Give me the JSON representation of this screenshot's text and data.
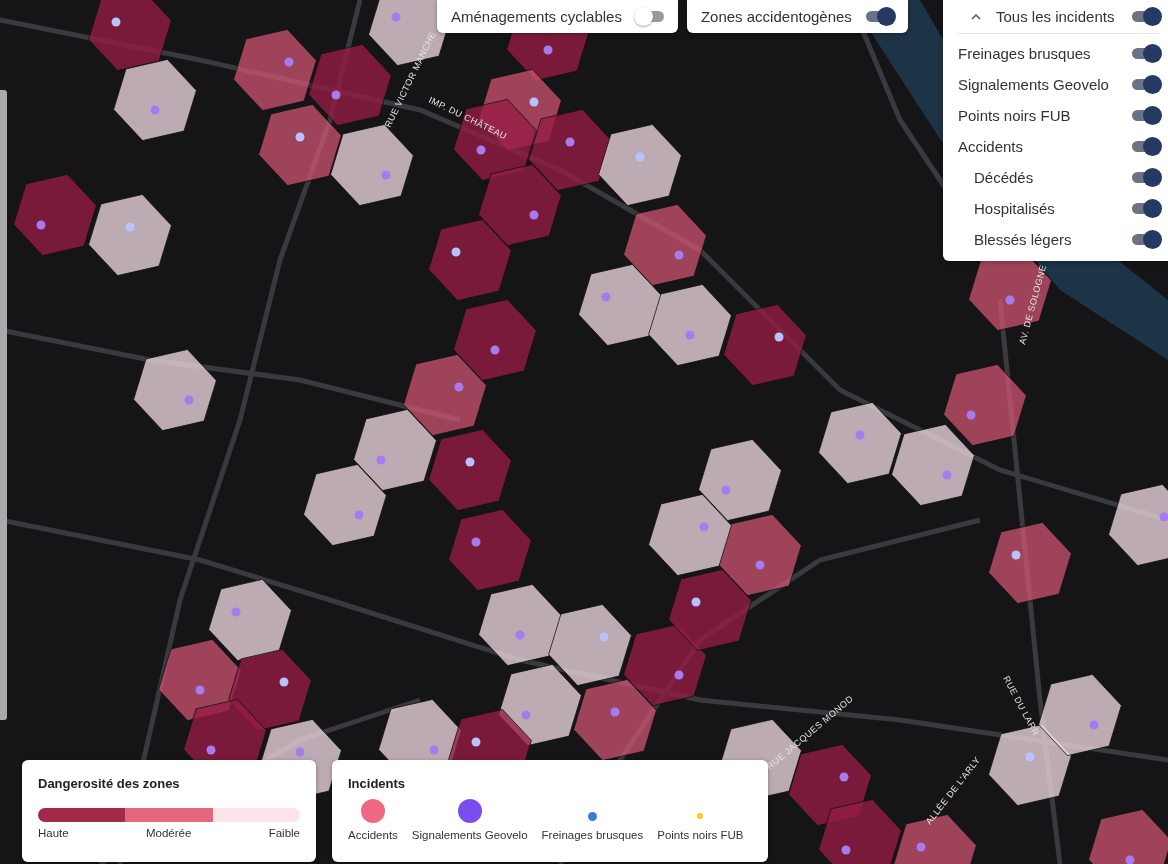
{
  "top_toggles": [
    {
      "label": "Aménagements cyclables",
      "on": false
    },
    {
      "label": "Zones accidentogènes",
      "on": true
    }
  ],
  "incident_filters": {
    "header": {
      "label": "Tous les incidents",
      "on": true,
      "expanded": true
    },
    "items": [
      {
        "label": "Freinages brusques",
        "on": true
      },
      {
        "label": "Signalements Geovelo",
        "on": true
      },
      {
        "label": "Points noirs FUB",
        "on": true
      },
      {
        "label": "Accidents",
        "on": true,
        "children": [
          {
            "label": "Décédés",
            "on": true
          },
          {
            "label": "Hospitalisés",
            "on": true
          },
          {
            "label": "Blessés légers",
            "on": true
          }
        ]
      }
    ]
  },
  "street_labels": [
    "RUE VICTOR MANCHE",
    "IMP. DU CHÂTEAU",
    "AV. DE SOLOGNE",
    "RUE JACQUES MONOD",
    "ALLÉE DE L'ARLY",
    "RUE DU LARR"
  ],
  "danger_legend": {
    "title": "Dangerosité des zones",
    "levels": [
      {
        "label": "Haute",
        "color": "#a3294a"
      },
      {
        "label": "Modérée",
        "color": "#e5667f"
      },
      {
        "label": "Faible",
        "color": "#fde4e8"
      }
    ]
  },
  "incident_legend": {
    "title": "Incidents",
    "items": [
      {
        "label": "Accidents",
        "color": "#f0687f",
        "kind": "large"
      },
      {
        "label": "Signalements Geovelo",
        "color": "#7b4cf0",
        "kind": "large"
      },
      {
        "label": "Freinages brusques",
        "color": "#3d7be0",
        "kind": "small"
      },
      {
        "label": "Points noirs FUB",
        "color": "#f2d21c",
        "kind": "tiny"
      }
    ]
  }
}
